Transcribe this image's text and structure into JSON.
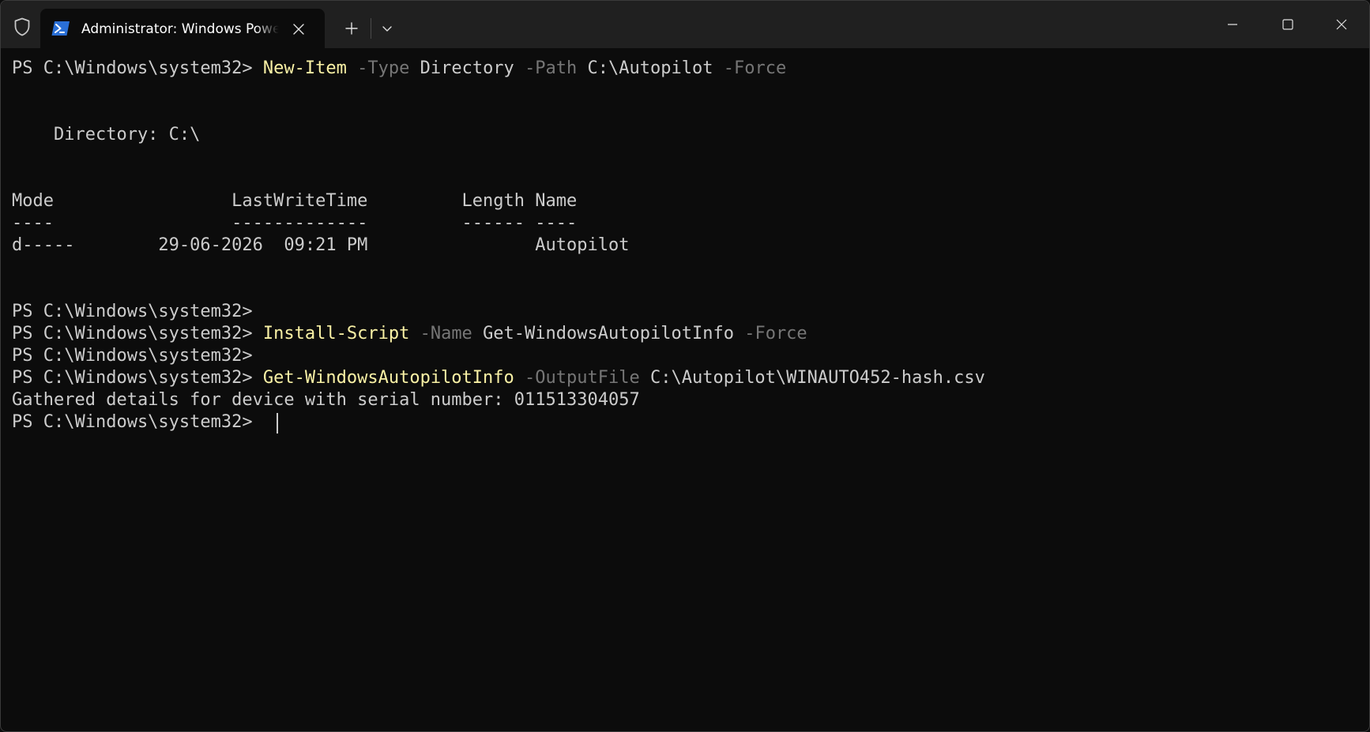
{
  "window": {
    "tab_title": "Administrator: Windows PowerShell",
    "icons": {
      "shield": "shield-icon",
      "powershell": "powershell-icon",
      "tab_close": "close-icon",
      "new_tab": "plus-icon",
      "dropdown": "chevron-down-icon",
      "minimize": "minimize-icon",
      "maximize": "maximize-icon",
      "close": "close-icon"
    }
  },
  "colors": {
    "background": "#0c0c0c",
    "titlebar": "#202020",
    "text": "#cccccc",
    "command": "#f9f1a5",
    "parameter": "#767676",
    "powershell_icon": "#2a6fd6"
  },
  "terminal": {
    "prompt": "PS C:\\Windows\\system32> ",
    "cmd1": {
      "name": "New-Item",
      "p1": "-Type",
      "v1": "Directory",
      "p2": "-Path",
      "v2": "C:\\Autopilot",
      "p3": "-Force"
    },
    "directory_line": "    Directory: C:\\",
    "table": {
      "header": "Mode                 LastWriteTime         Length Name",
      "underline": "----                 -------------         ------ ----",
      "row": "d-----        29-06-2026  09:21 PM                Autopilot"
    },
    "cmd2": {
      "name": "Install-Script",
      "p1": "-Name",
      "v1": "Get-WindowsAutopilotInfo",
      "p2": "-Force"
    },
    "cmd3": {
      "name": "Get-WindowsAutopilotInfo",
      "p1": "-OutputFile",
      "v1": "C:\\Autopilot\\WINAUTO452-hash.csv"
    },
    "output_line": "Gathered details for device with serial number: 011513304057"
  }
}
